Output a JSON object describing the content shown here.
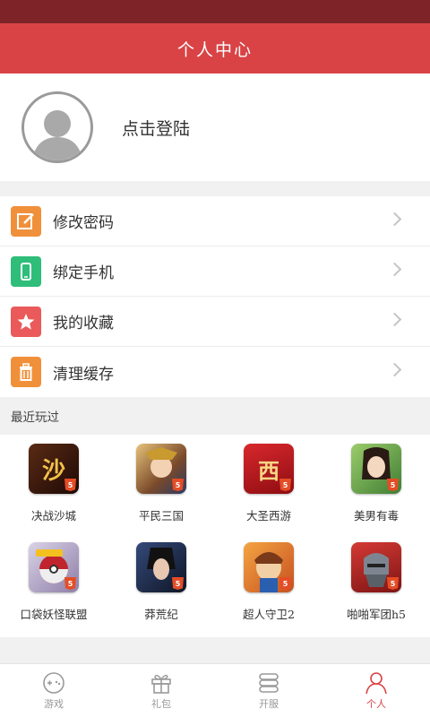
{
  "header": {
    "title": "个人中心"
  },
  "profile": {
    "login_label": "点击登陆"
  },
  "menu": [
    {
      "label": "修改密码",
      "icon": "edit-icon",
      "color": "#f1903b"
    },
    {
      "label": "绑定手机",
      "icon": "phone-icon",
      "color": "#2fbd7a"
    },
    {
      "label": "我的收藏",
      "icon": "star-icon",
      "color": "#ea5a5a"
    },
    {
      "label": "清理缓存",
      "icon": "trash-icon",
      "color": "#f1903b"
    }
  ],
  "recent": {
    "title": "最近玩过",
    "games": [
      {
        "name": "决战沙城",
        "glyph": "沙",
        "color": "#3a1510"
      },
      {
        "name": "平民三国",
        "glyph": "",
        "color": "#c9933b"
      },
      {
        "name": "大圣西游",
        "glyph": "西",
        "color": "#b4151b"
      },
      {
        "name": "美男有毒",
        "glyph": "",
        "color": "#5da14a"
      },
      {
        "name": "口袋妖怪联盟",
        "glyph": "",
        "color": "#c8c0d8"
      },
      {
        "name": "莽荒纪",
        "glyph": "",
        "color": "#1d2a44"
      },
      {
        "name": "超人守卫2",
        "glyph": "",
        "color": "#e07a2e"
      },
      {
        "name": "啪啪军团h5",
        "glyph": "",
        "color": "#b8282a"
      }
    ]
  },
  "tabs": [
    {
      "label": "游戏",
      "icon": "gamepad-icon",
      "active": false
    },
    {
      "label": "礼包",
      "icon": "gift-icon",
      "active": false
    },
    {
      "label": "开服",
      "icon": "server-icon",
      "active": false
    },
    {
      "label": "个人",
      "icon": "person-icon",
      "active": true
    }
  ],
  "colors": {
    "accent": "#d94346",
    "statusbar": "#7e2428"
  }
}
